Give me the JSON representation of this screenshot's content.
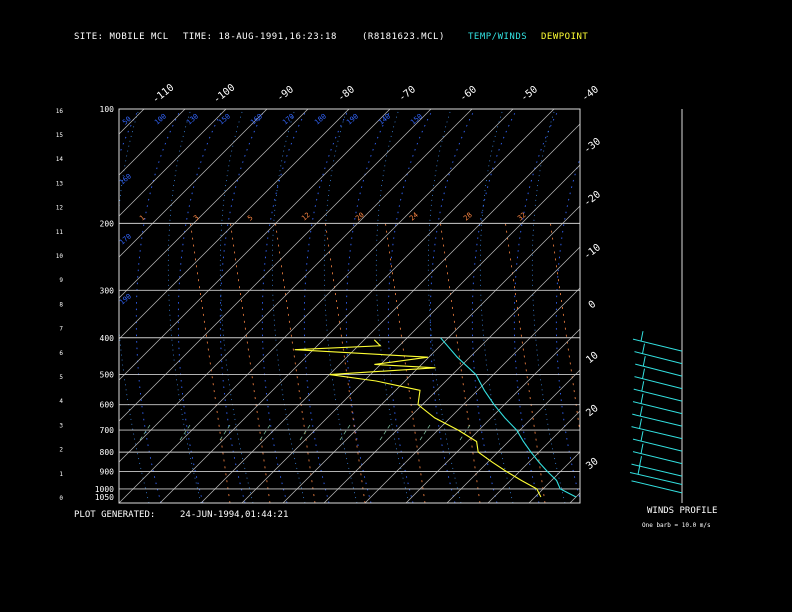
{
  "header": {
    "site": "SITE:  MOBILE MCL",
    "time": "TIME:    18-AUG-1991,16:23:18",
    "file": "(R8181623.MCL)",
    "legend_temp": "TEMP/WINDS",
    "legend_dew": "DEWPOINT"
  },
  "footer": {
    "plot_generated_label": "PLOT GENERATED:",
    "plot_generated_value": "24-JUN-1994,01:44:21",
    "wind_title": "WINDS PROFILE",
    "wind_note": "One barb = 10.0 m/s"
  },
  "colors": {
    "temp": "#33e0e0",
    "dewpoint": "#ffff33",
    "isobar": "#cccccc",
    "isotherm": "#bbbbbb",
    "dry_adiabat": "#3366ff",
    "moist_adiabat": "#4499ff",
    "mixing_ratio": "#ff8844",
    "wind": "#33e0e0"
  },
  "chart_data": {
    "type": "line",
    "diagram": "skew-T log-P",
    "pressure_labels_hpa": [
      100,
      200,
      300,
      400,
      500,
      600,
      700,
      800,
      900,
      1000,
      1050
    ],
    "height_labels_km": [
      0,
      1,
      2,
      3,
      4,
      5,
      6,
      7,
      8,
      9,
      10,
      11,
      12,
      13,
      14,
      15,
      16
    ],
    "top_temp_labels": [
      "-110",
      "-100",
      "-90",
      "-80",
      "-70",
      "-60",
      "-50",
      "-40"
    ],
    "right_temp_labels": [
      "-30",
      "-20",
      "-10",
      "0",
      "10",
      "20",
      "30"
    ],
    "mixing_ratio_labels": [
      "1",
      "3",
      "5",
      "12",
      "20",
      "24",
      "28",
      "32"
    ],
    "dry_adiabat_labels": [
      "50",
      "100",
      "130",
      "150",
      "160",
      "170",
      "180",
      "190",
      "140",
      "150",
      "160",
      "170",
      "190"
    ],
    "series": [
      {
        "name": "TEMP/WINDS",
        "points": [
          {
            "p": 1050,
            "t": 28
          },
          {
            "p": 1000,
            "t": 24
          },
          {
            "p": 950,
            "t": 22
          },
          {
            "p": 900,
            "t": 19
          },
          {
            "p": 850,
            "t": 16
          },
          {
            "p": 800,
            "t": 13
          },
          {
            "p": 750,
            "t": 10
          },
          {
            "p": 700,
            "t": 7
          },
          {
            "p": 650,
            "t": 3
          },
          {
            "p": 600,
            "t": -1
          },
          {
            "p": 550,
            "t": -5
          },
          {
            "p": 500,
            "t": -9
          },
          {
            "p": 450,
            "t": -15
          },
          {
            "p": 400,
            "t": -21
          }
        ]
      },
      {
        "name": "DEWPOINT",
        "points": [
          {
            "p": 1050,
            "t": 22
          },
          {
            "p": 1000,
            "t": 20
          },
          {
            "p": 950,
            "t": 16
          },
          {
            "p": 900,
            "t": 12
          },
          {
            "p": 850,
            "t": 8
          },
          {
            "p": 800,
            "t": 4
          },
          {
            "p": 750,
            "t": 2
          },
          {
            "p": 700,
            "t": -3
          },
          {
            "p": 650,
            "t": -9
          },
          {
            "p": 600,
            "t": -14
          },
          {
            "p": 550,
            "t": -16
          },
          {
            "p": 520,
            "t": -25
          },
          {
            "p": 500,
            "t": -34
          },
          {
            "p": 480,
            "t": -17
          },
          {
            "p": 470,
            "t": -28
          },
          {
            "p": 450,
            "t": -20
          },
          {
            "p": 430,
            "t": -44
          },
          {
            "p": 420,
            "t": -30
          },
          {
            "p": 405,
            "t": -32
          }
        ]
      }
    ],
    "winds": [
      {
        "z_km": 0.2,
        "dir_deg": 250,
        "speed_ms": 5
      },
      {
        "z_km": 0.6,
        "dir_deg": 240,
        "speed_ms": 10
      },
      {
        "z_km": 1.0,
        "dir_deg": 250,
        "speed_ms": 10
      },
      {
        "z_km": 1.6,
        "dir_deg": 260,
        "speed_ms": 10
      },
      {
        "z_km": 2.2,
        "dir_deg": 260,
        "speed_ms": 10
      },
      {
        "z_km": 2.8,
        "dir_deg": 250,
        "speed_ms": 10
      },
      {
        "z_km": 3.4,
        "dir_deg": 255,
        "speed_ms": 10
      },
      {
        "z_km": 4.0,
        "dir_deg": 260,
        "speed_ms": 10
      },
      {
        "z_km": 4.6,
        "dir_deg": 265,
        "speed_ms": 10
      },
      {
        "z_km": 5.2,
        "dir_deg": 270,
        "speed_ms": 10
      },
      {
        "z_km": 5.8,
        "dir_deg": 275,
        "speed_ms": 10
      },
      {
        "z_km": 6.4,
        "dir_deg": 270,
        "speed_ms": 10
      },
      {
        "z_km": 7.0,
        "dir_deg": 260,
        "speed_ms": 10
      }
    ]
  }
}
